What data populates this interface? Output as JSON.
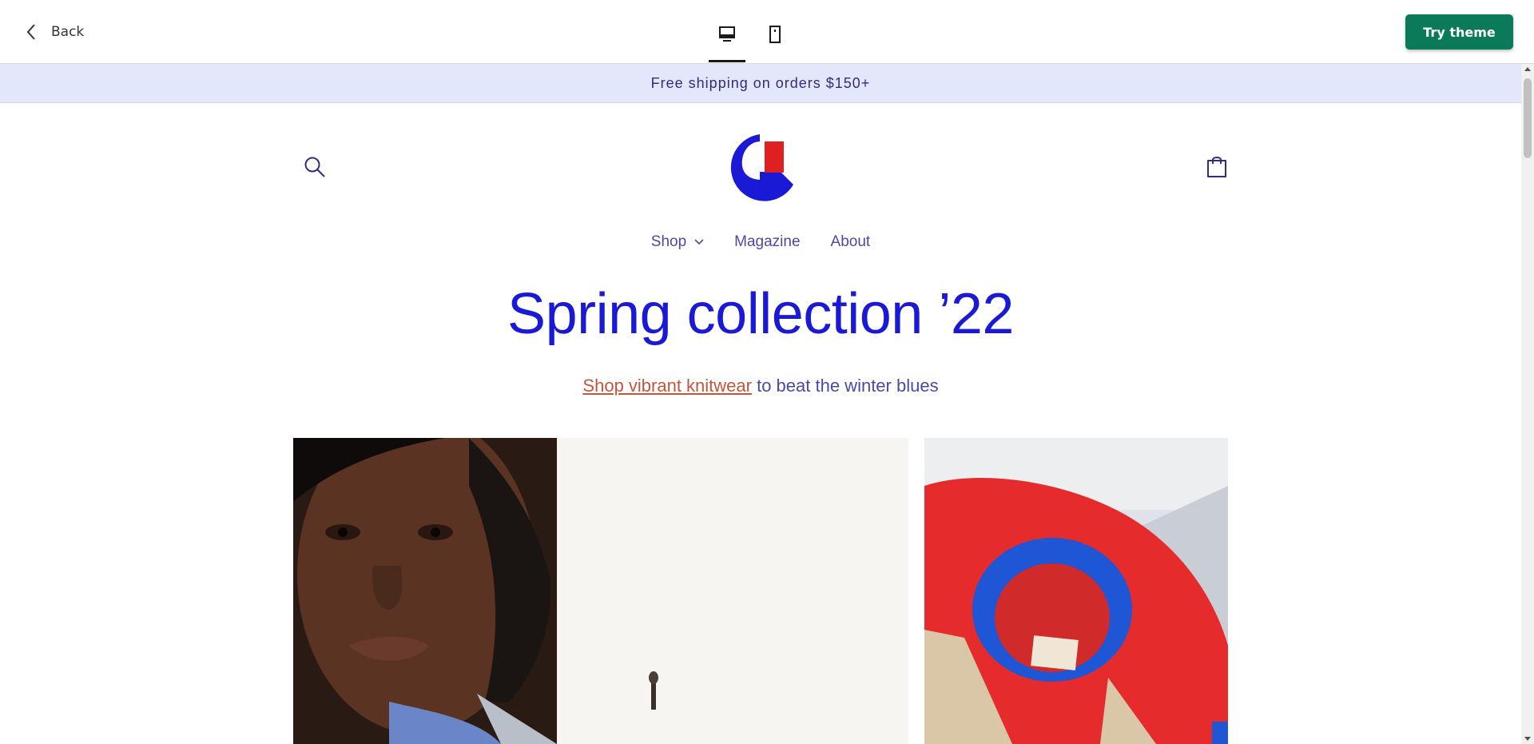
{
  "toolbar": {
    "back_label": "Back",
    "try_label": "Try theme",
    "accent": "#0a7a5a"
  },
  "announcement": {
    "text": "Free shipping on orders $150+"
  },
  "nav": {
    "items": [
      {
        "label": "Shop",
        "has_dropdown": true
      },
      {
        "label": "Magazine"
      },
      {
        "label": "About"
      }
    ]
  },
  "hero": {
    "title": "Spring collection ’22",
    "subtitle_link": "Shop vibrant knitwear",
    "subtitle_rest": " to beat the winter blues"
  },
  "colors": {
    "brand_blue": "#1a1ad6",
    "brand_red": "#e02020",
    "nav_text": "#4a4aa6",
    "link": "#c0563c",
    "announcement_bg": "#e3e7fb"
  }
}
